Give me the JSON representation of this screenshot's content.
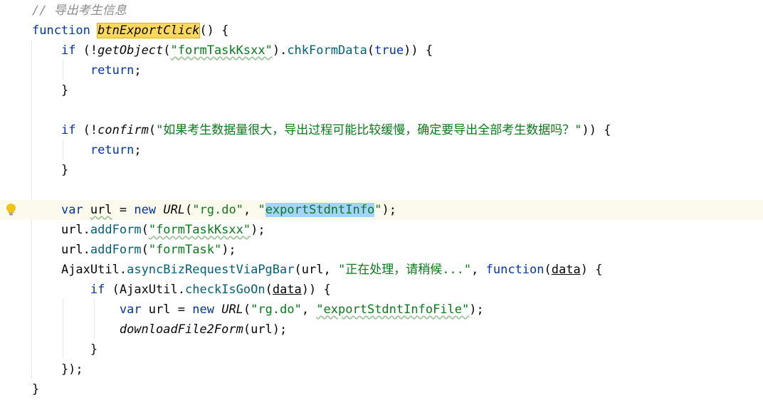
{
  "editor": {
    "lines": [
      {
        "tokens": [
          {
            "c": "cmt",
            "t": "// 导出考生信息"
          }
        ]
      },
      {
        "tokens": [
          {
            "c": "kw",
            "t": "function "
          },
          {
            "c": "fn-decl",
            "t": "btnExportClick"
          },
          {
            "c": "",
            "t": "() {"
          }
        ]
      },
      {
        "tokens": [
          {
            "c": "",
            "t": "    "
          },
          {
            "c": "kw",
            "t": "if"
          },
          {
            "c": "",
            "t": " (!"
          },
          {
            "c": "fn-ital",
            "t": "getObject"
          },
          {
            "c": "",
            "t": "("
          },
          {
            "c": "str",
            "t": "\"formTaskKsxx\""
          },
          {
            "c": "",
            "t": ")."
          },
          {
            "c": "fn-call",
            "t": "chkFormData"
          },
          {
            "c": "",
            "t": "("
          },
          {
            "c": "kw",
            "t": "true"
          },
          {
            "c": "",
            "t": ")) {"
          }
        ]
      },
      {
        "tokens": [
          {
            "c": "",
            "t": "        "
          },
          {
            "c": "kw",
            "t": "return"
          },
          {
            "c": "",
            "t": ";"
          }
        ]
      },
      {
        "tokens": [
          {
            "c": "",
            "t": "    }"
          }
        ]
      },
      {
        "tokens": [
          {
            "c": "",
            "t": ""
          }
        ]
      },
      {
        "tokens": [
          {
            "c": "",
            "t": "    "
          },
          {
            "c": "kw",
            "t": "if"
          },
          {
            "c": "",
            "t": " (!"
          },
          {
            "c": "fn-ital",
            "t": "confirm"
          },
          {
            "c": "",
            "t": "("
          },
          {
            "c": "str",
            "t": "\"如果考生数据量很大，导出过程可能比较缓慢，确定要导出全部考生数据吗？\""
          },
          {
            "c": "",
            "t": ")) {"
          }
        ]
      },
      {
        "tokens": [
          {
            "c": "",
            "t": "        "
          },
          {
            "c": "kw",
            "t": "return"
          },
          {
            "c": "",
            "t": ";"
          }
        ]
      },
      {
        "tokens": [
          {
            "c": "",
            "t": "    }"
          }
        ]
      },
      {
        "tokens": [
          {
            "c": "",
            "t": ""
          }
        ]
      },
      {
        "tokens": [
          {
            "c": "",
            "t": "    "
          },
          {
            "c": "kw",
            "t": "var"
          },
          {
            "c": "",
            "t": " "
          },
          {
            "c": "local",
            "t": "url"
          },
          {
            "c": "",
            "t": " = "
          },
          {
            "c": "kw",
            "t": "new"
          },
          {
            "c": "",
            "t": " "
          },
          {
            "c": "fn-ital",
            "t": "URL"
          },
          {
            "c": "",
            "t": "("
          },
          {
            "c": "str",
            "t": "\"rg.do\""
          },
          {
            "c": "",
            "t": ", "
          },
          {
            "c": "str",
            "t": "\""
          },
          {
            "c": "str sel",
            "t": "exportStdntInfo"
          },
          {
            "c": "str",
            "t": "\""
          },
          {
            "c": "",
            "t": ");"
          }
        ]
      },
      {
        "tokens": [
          {
            "c": "",
            "t": "    "
          },
          {
            "c": "local",
            "t": "url"
          },
          {
            "c": "",
            "t": "."
          },
          {
            "c": "fn-call",
            "t": "addForm"
          },
          {
            "c": "",
            "t": "("
          },
          {
            "c": "str",
            "t": "\"formTaskKsxx\""
          },
          {
            "c": "",
            "t": ");"
          }
        ]
      },
      {
        "tokens": [
          {
            "c": "",
            "t": "    "
          },
          {
            "c": "local",
            "t": "url"
          },
          {
            "c": "",
            "t": "."
          },
          {
            "c": "fn-call",
            "t": "addForm"
          },
          {
            "c": "",
            "t": "("
          },
          {
            "c": "str",
            "t": "\"formTask\""
          },
          {
            "c": "",
            "t": ");"
          }
        ]
      },
      {
        "tokens": [
          {
            "c": "",
            "t": "    "
          },
          {
            "c": "class-ref",
            "t": "AjaxUtil"
          },
          {
            "c": "",
            "t": "."
          },
          {
            "c": "fn-call",
            "t": "asyncBizRequestViaPgBar"
          },
          {
            "c": "",
            "t": "("
          },
          {
            "c": "local",
            "t": "url"
          },
          {
            "c": "",
            "t": ", "
          },
          {
            "c": "str",
            "t": "\"正在处理，请稍候...\""
          },
          {
            "c": "",
            "t": ", "
          },
          {
            "c": "kw",
            "t": "function"
          },
          {
            "c": "",
            "t": "("
          },
          {
            "c": "param",
            "t": "data"
          },
          {
            "c": "",
            "t": ") {"
          }
        ]
      },
      {
        "tokens": [
          {
            "c": "",
            "t": "        "
          },
          {
            "c": "kw",
            "t": "if"
          },
          {
            "c": "",
            "t": " ("
          },
          {
            "c": "class-ref",
            "t": "AjaxUtil"
          },
          {
            "c": "",
            "t": "."
          },
          {
            "c": "fn-call",
            "t": "checkIsGoOn"
          },
          {
            "c": "",
            "t": "("
          },
          {
            "c": "param",
            "t": "data"
          },
          {
            "c": "",
            "t": ")) {"
          }
        ]
      },
      {
        "tokens": [
          {
            "c": "",
            "t": "            "
          },
          {
            "c": "kw",
            "t": "var"
          },
          {
            "c": "",
            "t": " "
          },
          {
            "c": "local",
            "t": "url"
          },
          {
            "c": "",
            "t": " = "
          },
          {
            "c": "kw",
            "t": "new"
          },
          {
            "c": "",
            "t": " "
          },
          {
            "c": "fn-ital",
            "t": "URL"
          },
          {
            "c": "",
            "t": "("
          },
          {
            "c": "str",
            "t": "\"rg.do\""
          },
          {
            "c": "",
            "t": ", "
          },
          {
            "c": "str",
            "t": "\"exportStdntInfoFile\""
          },
          {
            "c": "",
            "t": ");"
          }
        ]
      },
      {
        "tokens": [
          {
            "c": "",
            "t": "            "
          },
          {
            "c": "fn-ital",
            "t": "downloadFile2Form"
          },
          {
            "c": "",
            "t": "("
          },
          {
            "c": "local",
            "t": "url"
          },
          {
            "c": "",
            "t": ");"
          }
        ]
      },
      {
        "tokens": [
          {
            "c": "",
            "t": "        }"
          }
        ]
      },
      {
        "tokens": [
          {
            "c": "",
            "t": "    });"
          }
        ]
      },
      {
        "tokens": [
          {
            "c": "",
            "t": "}"
          }
        ]
      }
    ],
    "current_line": 10,
    "bulb_icon": "lightbulb-icon",
    "colors": {
      "keyword": "#0033b3",
      "string": "#067d17",
      "comment": "#8c8c8c",
      "method": "#00627a",
      "selection": "#a6d2ff",
      "current_line": "#fcfaed",
      "decl_highlight": "#fcd95d"
    }
  }
}
